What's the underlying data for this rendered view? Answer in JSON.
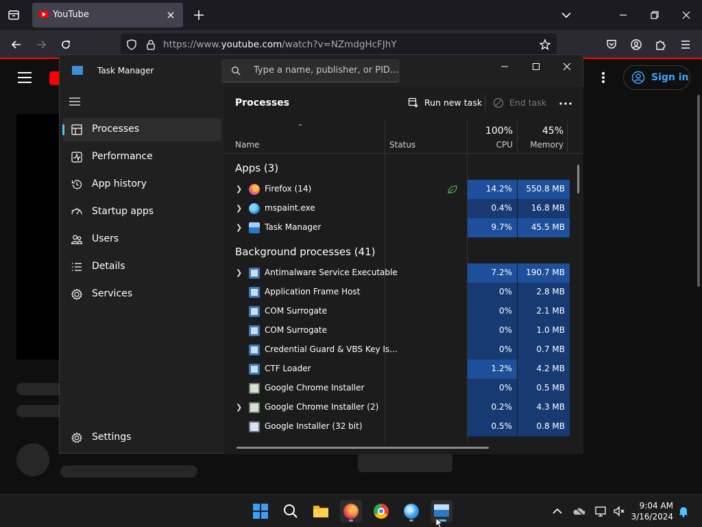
{
  "browser": {
    "tab_title": "YouTube",
    "url_prefix": "https://www.",
    "url_domain": "youtube.com",
    "url_rest": "/watch?v=NZmdgHcFJhY"
  },
  "youtube": {
    "sign_in": "Sign in"
  },
  "task_manager": {
    "title": "Task Manager",
    "search_placeholder": "Type a name, publisher, or PID...",
    "nav": [
      {
        "label": "Processes"
      },
      {
        "label": "Performance"
      },
      {
        "label": "App history"
      },
      {
        "label": "Startup apps"
      },
      {
        "label": "Users"
      },
      {
        "label": "Details"
      },
      {
        "label": "Services"
      }
    ],
    "settings_label": "Settings",
    "page_title": "Processes",
    "run_new_task": "Run new task",
    "end_task": "End task",
    "columns": {
      "name": "Name",
      "status": "Status",
      "cpu_total": "100%",
      "cpu": "CPU",
      "memory_total": "45%",
      "memory": "Memory"
    },
    "group_apps": "Apps (3)",
    "group_background": "Background processes (41)",
    "apps": [
      {
        "name": "Firefox (14)",
        "cpu": "14.2%",
        "memory": "550.8 MB"
      },
      {
        "name": "mspaint.exe",
        "cpu": "0.4%",
        "memory": "16.8 MB"
      },
      {
        "name": "Task Manager",
        "cpu": "9.7%",
        "memory": "45.5 MB"
      }
    ],
    "background": [
      {
        "name": "Antimalware Service Executable",
        "cpu": "7.2%",
        "memory": "190.7 MB"
      },
      {
        "name": "Application Frame Host",
        "cpu": "0%",
        "memory": "2.8 MB"
      },
      {
        "name": "COM Surrogate",
        "cpu": "0%",
        "memory": "2.1 MB"
      },
      {
        "name": "COM Surrogate",
        "cpu": "0%",
        "memory": "1.0 MB"
      },
      {
        "name": "Credential Guard & VBS Key Is...",
        "cpu": "0%",
        "memory": "0.7 MB"
      },
      {
        "name": "CTF Loader",
        "cpu": "1.2%",
        "memory": "4.2 MB"
      },
      {
        "name": "Google Chrome Installer",
        "cpu": "0%",
        "memory": "0.5 MB"
      },
      {
        "name": "Google Chrome Installer (2)",
        "cpu": "0.2%",
        "memory": "4.3 MB"
      },
      {
        "name": "Google Installer (32 bit)",
        "cpu": "0.5%",
        "memory": "0.8 MB"
      }
    ]
  },
  "taskbar": {
    "time": "9:04 AM",
    "date": "3/16/2024"
  },
  "colors": {
    "accent": "#4cc2ff",
    "yt_red": "#ff0000",
    "heat_high": "#1e4f9a",
    "heat_low": "#173a73"
  }
}
